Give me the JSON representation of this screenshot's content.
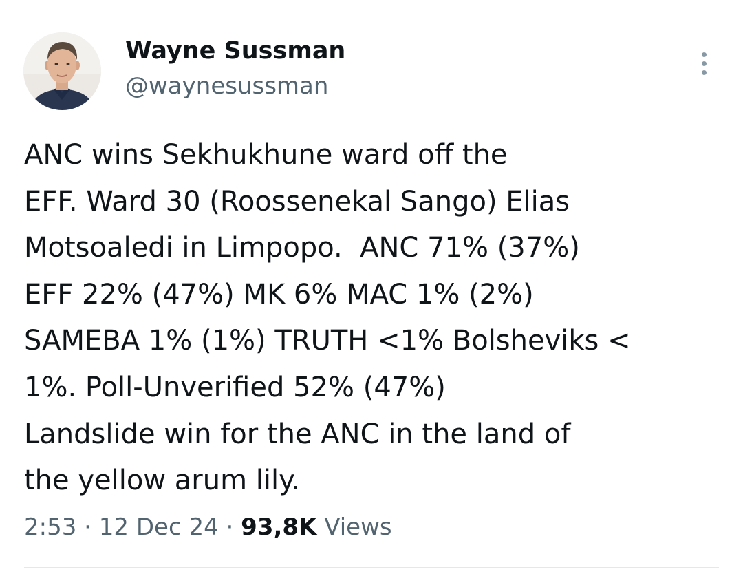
{
  "author": {
    "display_name": "Wayne Sussman",
    "handle": "@waynesussman"
  },
  "menu": {
    "icon": "more-vertical-icon"
  },
  "tweet": {
    "lines": [
      "ANC wins Sekhukhune ward off the",
      "EFF. Ward 30 (Roossenekal Sango) Elias",
      "Motsoaledi in Limpopo.  ANC 71% (37%)",
      "EFF 22% (47%) MK 6% MAC 1% (2%)",
      "SAMEBA 1% (1%) TRUTH <1% Bolsheviks <",
      "1%. Poll-Unverified 52% (47%)",
      "Landslide win for the ANC in the land of",
      "the yellow arum lily."
    ]
  },
  "meta": {
    "time": "2:53",
    "separator": " · ",
    "date": "12 Dec 24",
    "views_count": "93,8K",
    "views_label": " Views"
  },
  "colors": {
    "primary_text": "#0f1419",
    "secondary_text": "#536471",
    "divider": "#e4e8ec"
  }
}
